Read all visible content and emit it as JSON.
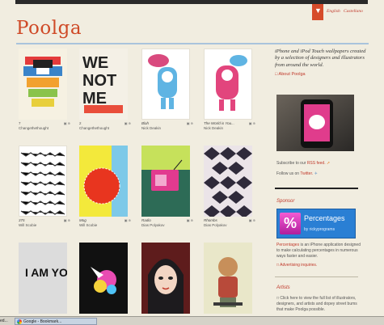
{
  "header": {
    "logo": "Poolga",
    "lang_english": "English",
    "lang_castellano": "Castellano"
  },
  "wallpapers": [
    {
      "num": "7",
      "author": "Changethethought"
    },
    {
      "num": "2",
      "author": "Changethethought"
    },
    {
      "title": "Blah",
      "author": "Nick Deakin"
    },
    {
      "title": "The World is You...",
      "author": "Nick Deakin"
    },
    {
      "title": "375",
      "author": "Will Scobie"
    },
    {
      "title": "Mog",
      "author": "Will Scobie"
    },
    {
      "title": "Radio",
      "author": "Dias Polyakov"
    },
    {
      "title": "Rhombs",
      "author": "Dias Polyakov"
    },
    {
      "art_text": "I AM YOU"
    }
  ],
  "sidebar": {
    "description": "iPhone and iPod Touch wallpapers created by a selection of designers and illustrators from around the world.",
    "about_link": "About Poolga",
    "rss_prefix": "Subscribe to our",
    "rss_link": "RSS feed.",
    "twitter_prefix": "Follow us on",
    "twitter_link": "Twitter.",
    "sponsor_heading": "Sponsor",
    "ad_title": "Percentages",
    "ad_sub": "by rickyprograms",
    "ad_glyph": "%",
    "ad_desc_link": "Percentages",
    "ad_desc": "is an iPhone application designed to make calculating percentages in numerous ways faster and easier.",
    "advertising_link": "Advertising inquiries.",
    "artists_heading": "Artists",
    "artists_text": "Click here to view the full list of illustrators, designers, and artists and dopey street bums that make Poolga possible."
  },
  "taskbar": {
    "left_label": "ed...",
    "button_label": "Google - Bookmark..."
  },
  "colors": {
    "background": "#f1ede0",
    "accent": "#cf4a27",
    "divider": "#a9c4dc"
  }
}
